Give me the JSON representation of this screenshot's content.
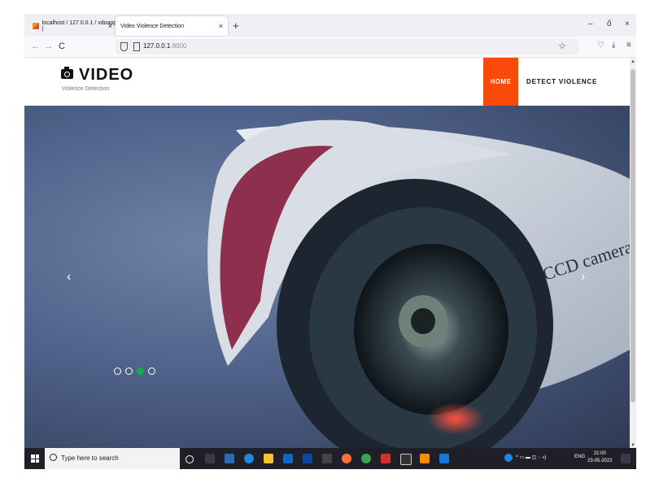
{
  "browser": {
    "tabs": [
      {
        "title": "localhost / 127.0.0.1 / vdoapp |",
        "active": false
      },
      {
        "title": "Video Violence Detection",
        "active": true
      }
    ],
    "new_tab": "+",
    "window_controls": {
      "minimize": "–",
      "maximize": "ő",
      "close": "×"
    },
    "nav": {
      "back": "←",
      "forward": "→",
      "reload": "C"
    },
    "address": {
      "host": "127.0.0.1",
      "port": ":8000"
    },
    "bookmark": "☆",
    "right_icons": {
      "pocket": "♡",
      "downloads": "⤓",
      "menu": "≡"
    }
  },
  "site": {
    "logo": {
      "brand": "VIDEO",
      "tagline": "Violence Detection",
      "icon": "camera-icon"
    },
    "menu": [
      {
        "label": "HOME",
        "active": true,
        "color": "#fa4a0a"
      },
      {
        "label": "DETECT VIOLENCE",
        "active": false
      }
    ]
  },
  "hero": {
    "prev": "‹",
    "next": "›",
    "slide_count": 4,
    "active_slide": 3,
    "active_color": "#0bb34a",
    "image_text": "CCD camera"
  },
  "taskbar": {
    "search_placeholder": "Type here to search",
    "tray_lang": "ENG",
    "time": "21:00",
    "date": "23-05-2022"
  }
}
